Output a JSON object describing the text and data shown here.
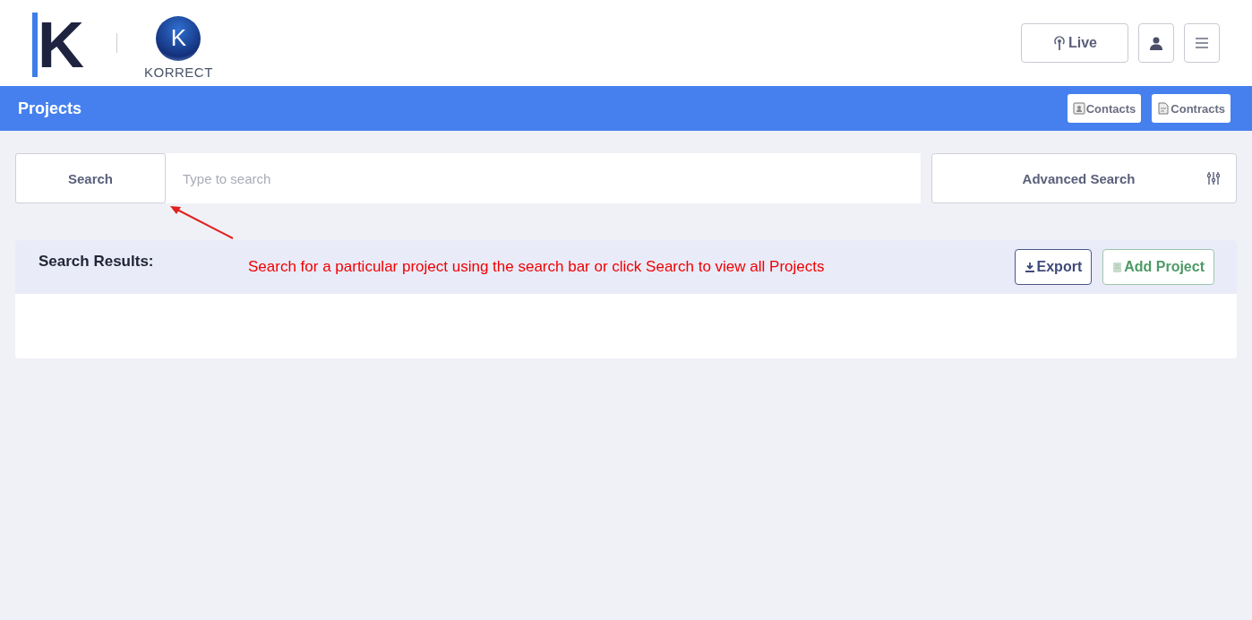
{
  "header": {
    "logo_letter": "K",
    "brand_letter": "K",
    "brand_name": "KORRECT",
    "buttons": [
      {
        "kind": "live",
        "label": "Live"
      },
      {
        "kind": "user"
      },
      {
        "kind": "menu"
      }
    ]
  },
  "title_bar": {
    "title": "Projects",
    "buttons": [
      {
        "kind": "contacts",
        "label": "Contacts"
      },
      {
        "kind": "contracts",
        "label": "Contracts"
      }
    ]
  },
  "search": {
    "button": "Search",
    "placeholder": "Type to search",
    "advanced": "Advanced Search"
  },
  "results": {
    "title": "Search Results:",
    "buttons": [
      {
        "kind": "export",
        "label": "Export"
      },
      {
        "kind": "add",
        "label": "Add Project"
      }
    ]
  },
  "annotation": {
    "text": "Search for a particular project using the search bar or click Search to view all Projects"
  }
}
